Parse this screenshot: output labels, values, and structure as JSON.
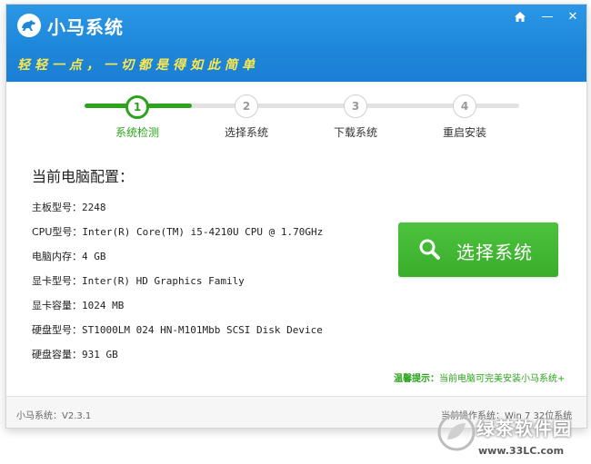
{
  "app": {
    "title": "小马系统",
    "slogan": "轻轻一点，一切都是得如此简单"
  },
  "colors": {
    "header_blue": "#1e87da",
    "accent_green": "#2ba31b",
    "button_green": "#3aae2b",
    "slogan_yellow": "#ffe94a"
  },
  "window_controls": {
    "home_icon": "home-icon",
    "minimize_glyph": "—",
    "close_glyph": "✕"
  },
  "steps": [
    {
      "number": "1",
      "label": "系统检测",
      "active": true
    },
    {
      "number": "2",
      "label": "选择系统",
      "active": false
    },
    {
      "number": "3",
      "label": "下载系统",
      "active": false
    },
    {
      "number": "4",
      "label": "重启安装",
      "active": false
    }
  ],
  "config": {
    "title": "当前电脑配置：",
    "rows": [
      {
        "label": "主板型号：",
        "value": "2248"
      },
      {
        "label": "CPU型号：",
        "value": "Inter(R) Core(TM) i5-4210U CPU @ 1.70GHz"
      },
      {
        "label": "电脑内存：",
        "value": "4 GB"
      },
      {
        "label": "显卡型号：",
        "value": "Inter(R) HD Graphics Family"
      },
      {
        "label": "显卡容量：",
        "value": "1024 MB"
      },
      {
        "label": "硬盘型号：",
        "value": "ST1000LM 024 HN-M101Mbb SCSI Disk Device"
      },
      {
        "label": "硬盘容量：",
        "value": "931 GB"
      }
    ]
  },
  "primary_button": {
    "label": "选择系统",
    "icon": "search-icon"
  },
  "tip": {
    "label": "温馨提示：",
    "text": "当前电脑可完美安装小马系统+"
  },
  "footer": {
    "version": "小马系统：V2.3.1",
    "os_info": "当前操作系统：Win 7 32位系统"
  },
  "watermark": {
    "text": "绿茶软件园",
    "url": "www.33LC.com"
  }
}
